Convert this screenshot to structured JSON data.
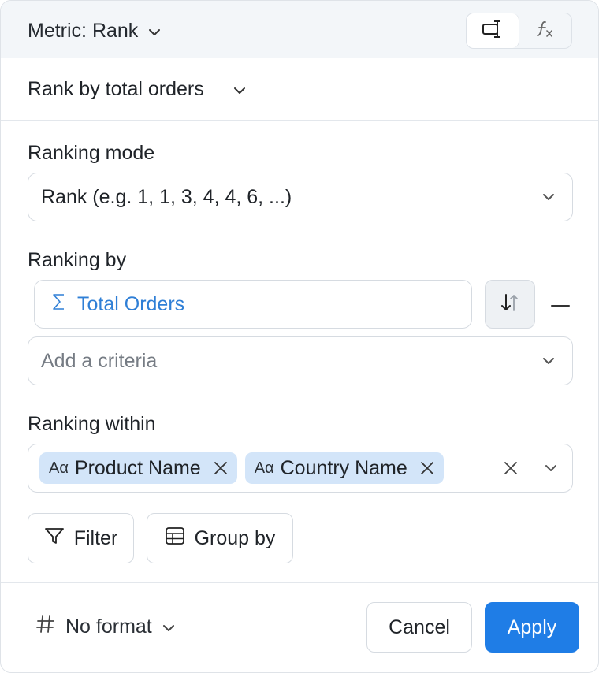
{
  "header": {
    "metric_label": "Metric: Rank",
    "modes": [
      {
        "icon": "column-cursor-icon",
        "active": true
      },
      {
        "icon": "function-fx-icon",
        "active": false
      }
    ]
  },
  "name": {
    "value": "Rank by total orders"
  },
  "ranking_mode": {
    "label": "Ranking mode",
    "selected": "Rank (e.g. 1, 1, 3, 4, 4, 6, ...)"
  },
  "ranking_by": {
    "label": "Ranking by",
    "field": {
      "icon": "sigma-icon",
      "name": "Total Orders"
    },
    "sort_icon": "sort-desc-icon",
    "add_placeholder": "Add a criteria"
  },
  "ranking_within": {
    "label": "Ranking within",
    "tags": [
      {
        "type_icon": "Aα",
        "name": "Product Name"
      },
      {
        "type_icon": "Aα",
        "name": "Country Name"
      }
    ]
  },
  "actions": {
    "filter_label": "Filter",
    "group_by_label": "Group by"
  },
  "footer": {
    "format_label": "No format",
    "cancel_label": "Cancel",
    "apply_label": "Apply"
  },
  "colors": {
    "accent": "#1f7de6",
    "tag_bg": "#d3e5f9",
    "field_text": "#2f7fd6",
    "header_bg": "#f3f6f9"
  }
}
